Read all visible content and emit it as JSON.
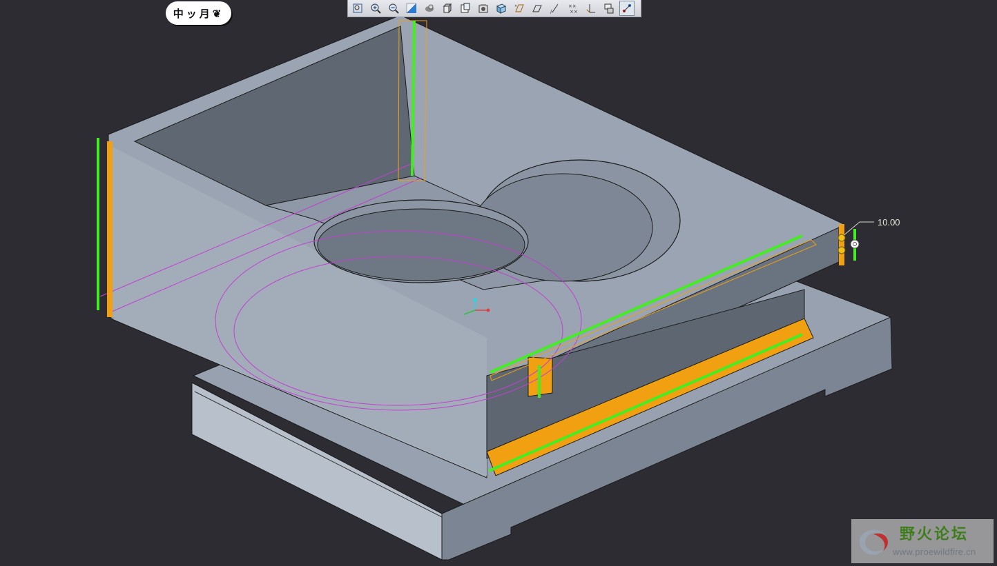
{
  "toolbar": {
    "buttons": [
      {
        "name": "refit-icon"
      },
      {
        "name": "zoom-in-icon"
      },
      {
        "name": "zoom-out-icon"
      },
      {
        "name": "repaint-icon"
      },
      {
        "name": "spin-center-icon"
      },
      {
        "name": "named-views-icon"
      },
      {
        "name": "saved-views-icon"
      },
      {
        "name": "view-manager-icon"
      },
      {
        "name": "display-style-icon"
      },
      {
        "name": "datum-planes-icon"
      },
      {
        "name": "datum-axes-icon"
      },
      {
        "name": "datum-points-icon"
      },
      {
        "name": "coordinate-systems-icon"
      },
      {
        "name": "annotations-icon"
      },
      {
        "name": "spin-center-toggle-icon"
      },
      {
        "name": "orient-mode-icon"
      }
    ],
    "active_index": 15
  },
  "logo_bubble": {
    "text": "中ッ月❦"
  },
  "dimension": {
    "value": "10.00"
  },
  "watermark": {
    "title": "野火论坛",
    "url": "www.proewildfire.cn"
  },
  "colors": {
    "background": "#2c2c32",
    "model_top": "#9aa4b2",
    "model_side": "#6a7480",
    "highlight_edge": "#44ee22",
    "selected_surface": "#f0a010",
    "sketch_curve": "#c040d0"
  }
}
